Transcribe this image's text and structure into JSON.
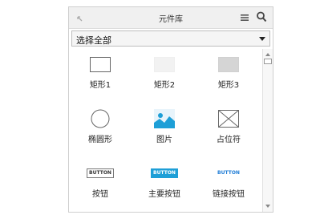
{
  "header": {
    "title": "元件库",
    "collapse_icon": "collapse-arrow-icon",
    "menu_icon": "hamburger-menu-icon",
    "search_icon": "search-icon"
  },
  "library_select": {
    "value": "选择全部"
  },
  "items": [
    {
      "label": "矩形1",
      "icon": "rectangle-outline-icon"
    },
    {
      "label": "矩形2",
      "icon": "rectangle-light-fill-icon"
    },
    {
      "label": "矩形3",
      "icon": "rectangle-gray-fill-icon"
    },
    {
      "label": "椭圆形",
      "icon": "ellipse-icon"
    },
    {
      "label": "图片",
      "icon": "image-icon"
    },
    {
      "label": "占位符",
      "icon": "placeholder-icon"
    },
    {
      "label": "按钮",
      "icon": "button-icon",
      "glyph": "BUTTON"
    },
    {
      "label": "主要按钮",
      "icon": "primary-button-icon",
      "glyph": "BUTTON"
    },
    {
      "label": "链接按钮",
      "icon": "link-button-icon",
      "glyph": "BUTTON"
    }
  ],
  "colors": {
    "primary": "#1e9fd7",
    "link": "#1e7cd6",
    "header_bg": "#f0f0f0",
    "border": "#cfcfcf"
  }
}
